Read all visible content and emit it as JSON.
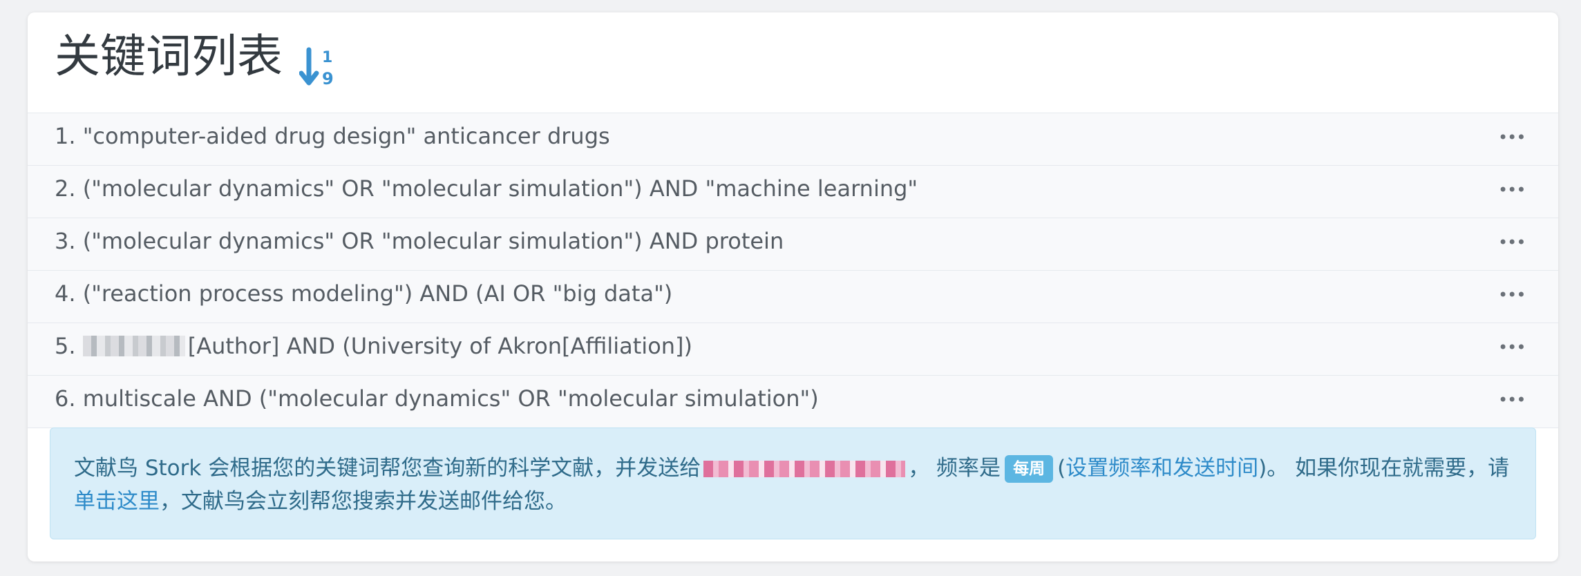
{
  "header": {
    "title": "关键词列表",
    "sort_icon": "sort-numeric-ascending-icon",
    "sort_icon_text_top": "1",
    "sort_icon_text_bottom": "9"
  },
  "keywords": [
    {
      "index": "1.",
      "text": "\"computer-aided drug design\" anticancer drugs"
    },
    {
      "index": "2.",
      "text": "(\"molecular dynamics\" OR \"molecular simulation\") AND \"machine learning\""
    },
    {
      "index": "3.",
      "text": "(\"molecular dynamics\" OR \"molecular simulation\") AND protein"
    },
    {
      "index": "4.",
      "text": "(\"reaction process modeling\") AND (AI OR \"big data\")"
    },
    {
      "index": "5.",
      "text": "[Author] AND (University of Akron[Affiliation])"
    },
    {
      "index": "6.",
      "text": "multiscale AND (\"molecular dynamics\" OR \"molecular simulation\")"
    }
  ],
  "more_menu_label": "•••",
  "info": {
    "part1": "文献鸟 Stork 会根据您的关键词帮您查询新的科学文献，并发送给",
    "part2": "， 频率是",
    "frequency_badge": "每周",
    "link_settings": "设置频率和发送时间",
    "part3": "。 如果你现在就需要，请",
    "link_click_here": "单击这里",
    "part4": "，文献鸟会立刻帮您搜索并发送邮件给您。"
  },
  "colors": {
    "accent": "#2e8bc9",
    "info_bg": "#d9eef9",
    "badge_bg": "#5cb6e2"
  }
}
